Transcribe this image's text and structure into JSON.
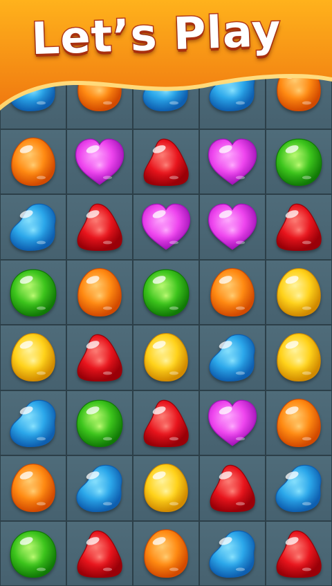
{
  "header": {
    "title": "Let’s Play"
  },
  "colors": {
    "banner_top": "#ffb21c",
    "banner_bottom": "#f07a10",
    "board_bg": "#46616f",
    "grid_line": "#2c3f48"
  },
  "board": {
    "rows": [
      [
        "blue-bean",
        "orange-egg",
        "blue-bean",
        "blue-bean",
        "orange-egg"
      ],
      [
        "orange-egg",
        "pink-heart",
        "red-drop",
        "pink-heart",
        "green-round"
      ],
      [
        "blue-bean",
        "red-drop",
        "pink-heart",
        "pink-heart",
        "red-drop"
      ],
      [
        "green-round",
        "orange-egg",
        "green-round",
        "orange-egg",
        "yellow-egg"
      ],
      [
        "yellow-egg",
        "red-drop",
        "yellow-egg",
        "blue-bean",
        "yellow-egg"
      ],
      [
        "blue-bean",
        "green-round",
        "red-drop",
        "pink-heart",
        "orange-egg"
      ],
      [
        "orange-egg",
        "blue-bean",
        "yellow-egg",
        "red-drop",
        "blue-bean"
      ],
      [
        "green-round",
        "red-drop",
        "orange-egg",
        "blue-bean",
        "red-drop"
      ]
    ]
  }
}
